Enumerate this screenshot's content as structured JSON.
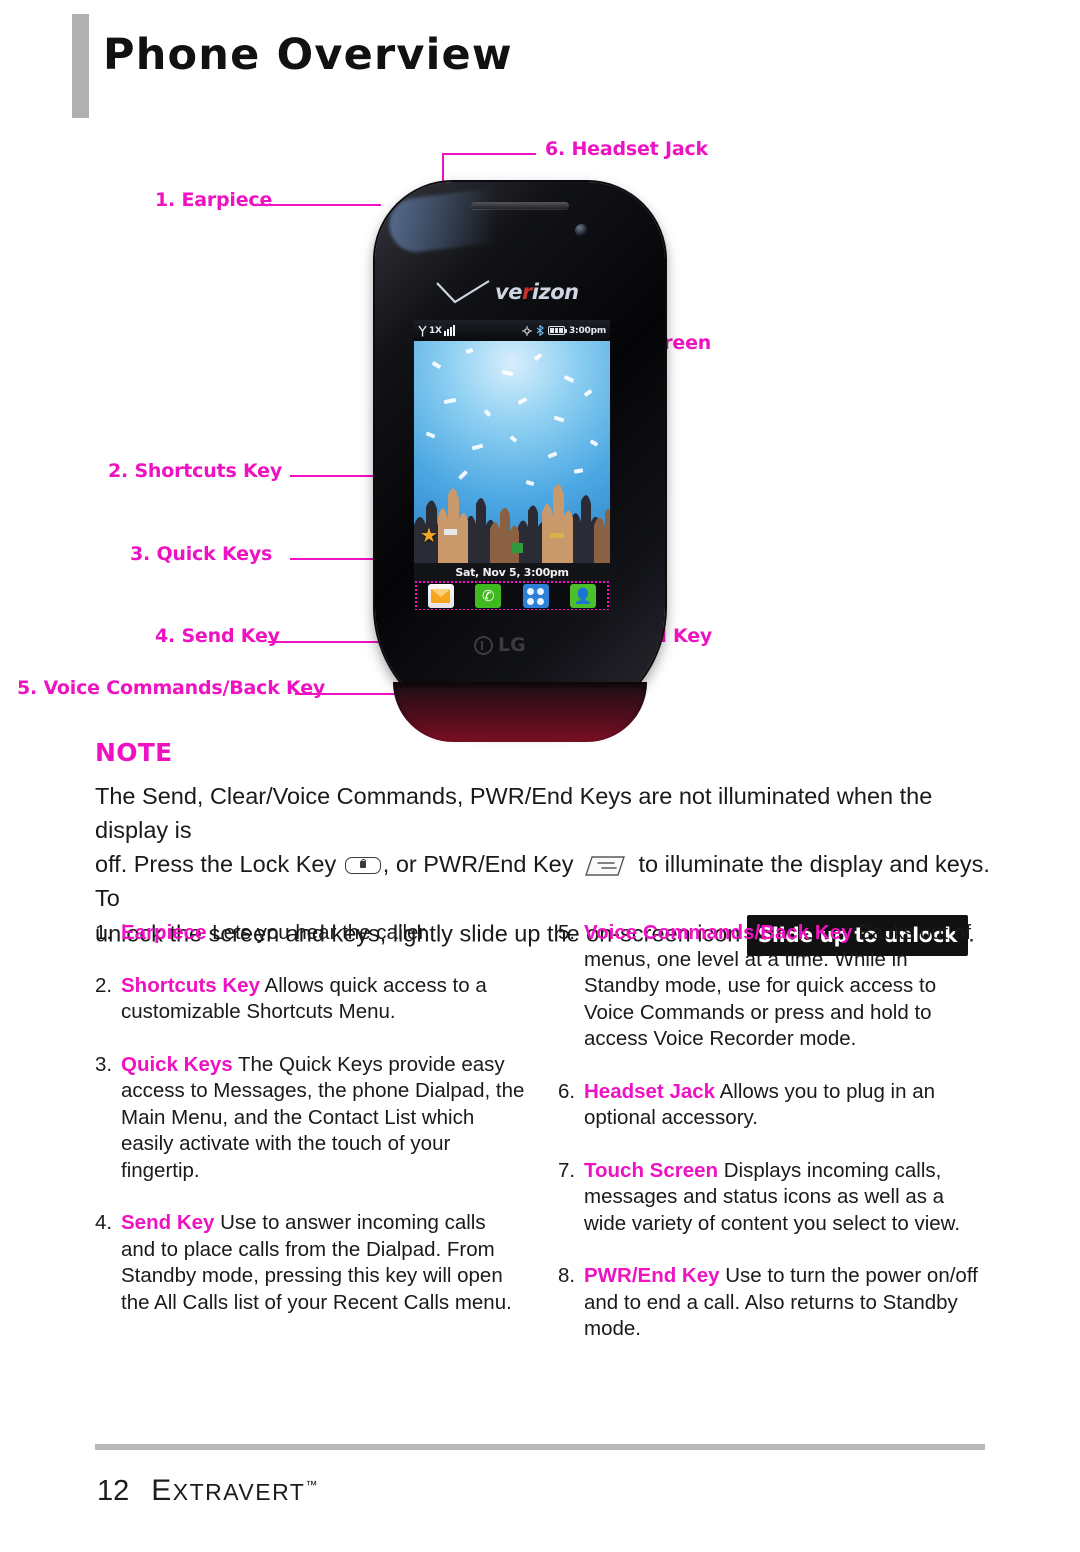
{
  "header": {
    "title": "Phone Overview"
  },
  "diagram": {
    "callouts": [
      {
        "id": 1,
        "text": "1. Earpiece"
      },
      {
        "id": 2,
        "text": "2. Shortcuts Key"
      },
      {
        "id": 3,
        "text": "3. Quick Keys"
      },
      {
        "id": 4,
        "text": "4. Send Key"
      },
      {
        "id": 5,
        "text": "5. Voice Commands/Back Key"
      },
      {
        "id": 6,
        "text": "6. Headset Jack"
      },
      {
        "id": 7,
        "text": "7.  Touch Screen"
      },
      {
        "id": 8,
        "text": "8. PWR/End Key"
      }
    ],
    "phone": {
      "carrier": "verizon",
      "brand": "LG",
      "status_bar": {
        "network": "1X",
        "time": "3:00pm"
      },
      "date_bar": "Sat, Nov 5, 3:00pm",
      "quick_keys": [
        "messages-icon",
        "dialpad-icon",
        "main-menu-icon",
        "contacts-icon"
      ],
      "shortcut_icon": "star-icon"
    }
  },
  "note": {
    "title": "NOTE",
    "line1": "The Send, Clear/Voice Commands, PWR/End Keys are not illuminated when the display is",
    "line2a": "off. Press the Lock Key",
    "line2b": ", or PWR/End Key",
    "line2c": "to illuminate the display and keys. To",
    "line3a": "unlock the screen and keys, lightly slide up the on-screen icon",
    "unlock_badge": "Slide up to unlock",
    "line3b": "."
  },
  "definitions": {
    "left": [
      {
        "num": "1.",
        "term": "Earpiece",
        "desc": " Lets you hear the caller."
      },
      {
        "num": "2.",
        "term": "Shortcuts Key",
        "desc": " Allows quick access to a customizable Shortcuts Menu."
      },
      {
        "num": "3.",
        "term": "Quick Keys",
        "desc": " The Quick Keys provide easy access to Messages, the phone Dialpad, the Main Menu, and the Contact List which easily activate with the touch of your fingertip."
      },
      {
        "num": "4.",
        "term": "Send Key",
        "desc": " Use to answer incoming calls and to place calls from the Dialpad. From Standby mode, pressing this key will open the All Calls list of your Recent Calls menu."
      }
    ],
    "right": [
      {
        "num": "5.",
        "term": "Voice Commands/Back Key",
        "desc": " Backs out of menus, one level at a time. While in Standby mode, use for quick access to Voice Commands or press and hold to access Voice Recorder mode."
      },
      {
        "num": "6.",
        "term": "Headset Jack",
        "desc": " Allows you to plug in an optional accessory."
      },
      {
        "num": "7.",
        "term": "Touch Screen",
        "desc": " Displays incoming calls, messages and status icons as well as a wide variety of content you select to view."
      },
      {
        "num": "8.",
        "term": "PWR/End Key",
        "desc": " Use to turn the power on/off and to end a call. Also returns to Standby mode."
      }
    ]
  },
  "footer": {
    "page_number": "12",
    "brand_e": "E",
    "brand_rest": "XTRAVERT",
    "trademark": "™"
  },
  "colors": {
    "accent": "#ef12c2",
    "rule": "#b8b8b8",
    "text": "#1a1a1a"
  }
}
